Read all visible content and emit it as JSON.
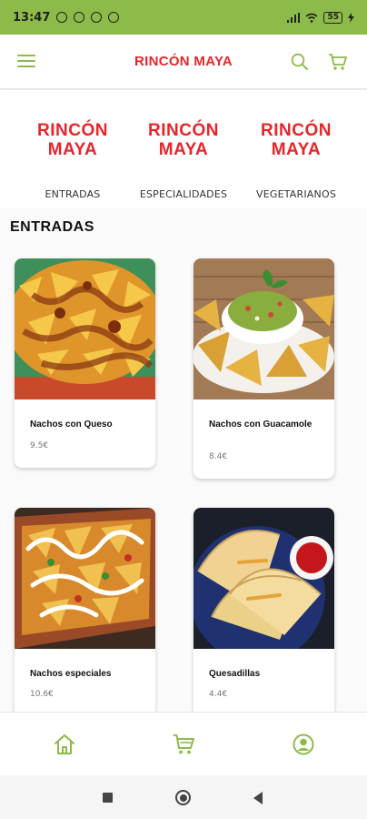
{
  "status_bar": {
    "time": "13:47",
    "battery": "55"
  },
  "app_bar": {
    "title": "RINCÓN MAYA"
  },
  "categories": [
    {
      "logo_line1": "RINCÓN",
      "logo_line2": "MAYA",
      "label": "ENTRADAS"
    },
    {
      "logo_line1": "RINCÓN",
      "logo_line2": "MAYA",
      "label": "ESPECIALIDADES"
    },
    {
      "logo_line1": "RINCÓN",
      "logo_line2": "MAYA",
      "label": "VEGETARIANOS"
    }
  ],
  "section": {
    "title": "ENTRADAS"
  },
  "products": [
    {
      "name": "Nachos con Queso",
      "price": "9.5€"
    },
    {
      "name": "Nachos con Guacamole",
      "price": "8.4€"
    },
    {
      "name": "Nachos especiales",
      "price": "10.6€"
    },
    {
      "name": "Quesadillas",
      "price": "4.4€"
    }
  ],
  "icons": {
    "menu": "menu-icon",
    "search": "search-icon",
    "cart": "cart-icon",
    "home": "home-icon",
    "profile": "profile-icon"
  },
  "colors": {
    "accent": "#8cbb4a",
    "brand_red": "#e8242b"
  }
}
